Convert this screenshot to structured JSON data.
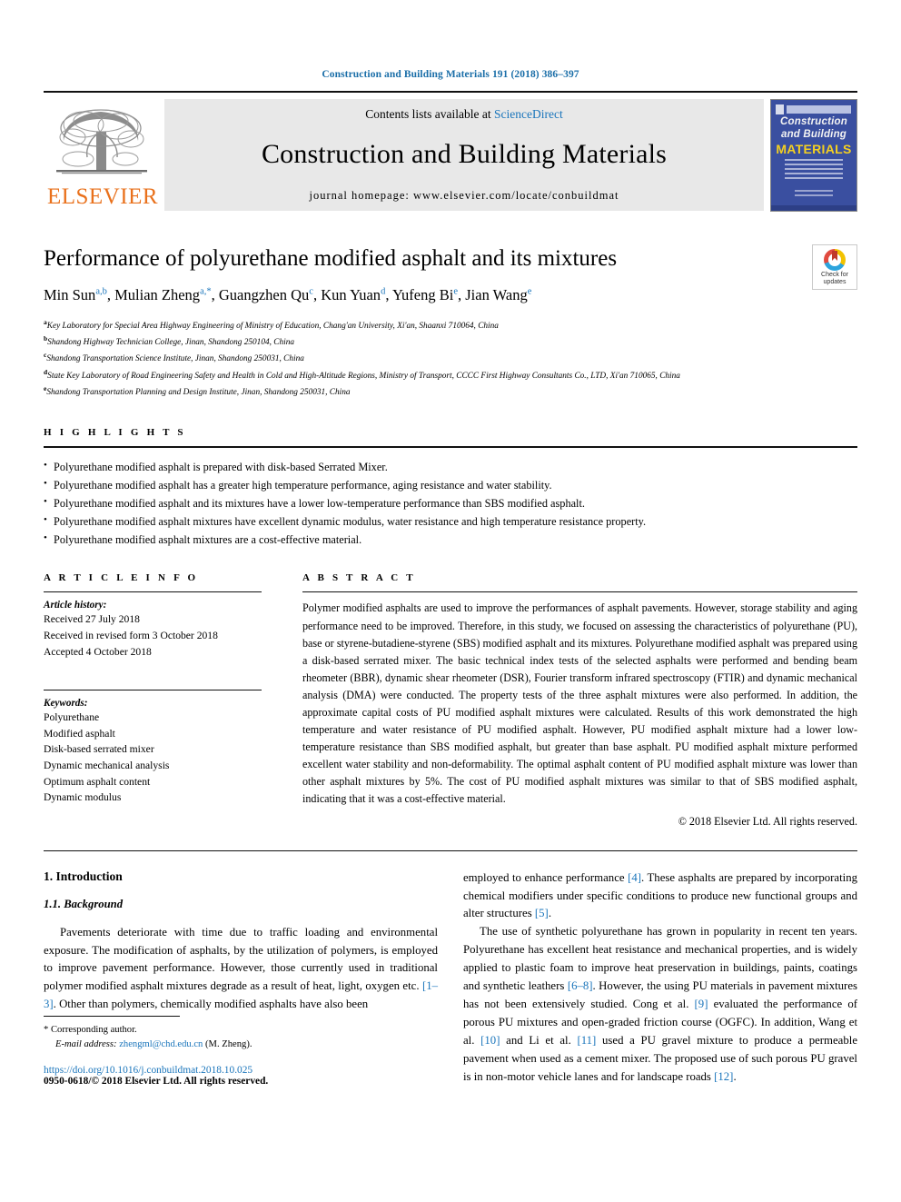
{
  "running_head": "Construction and Building Materials 191 (2018) 386–397",
  "masthead": {
    "contents_prefix": "Contents lists available at ",
    "sciencedirect": "ScienceDirect",
    "journal_title": "Construction and Building Materials",
    "homepage": "journal homepage: www.elsevier.com/locate/conbuildmat",
    "publisher": "ELSEVIER",
    "cover": {
      "line1": "Construction",
      "line2": "and Building",
      "line3": "MATERIALS"
    }
  },
  "title": "Performance of polyurethane modified asphalt and its mixtures",
  "crossmark": {
    "line1": "Check for",
    "line2": "updates"
  },
  "authors": [
    {
      "name": "Min Sun",
      "sup": "a,b"
    },
    {
      "name": "Mulian Zheng",
      "sup": "a,*"
    },
    {
      "name": "Guangzhen Qu",
      "sup": "c"
    },
    {
      "name": "Kun Yuan",
      "sup": "d"
    },
    {
      "name": "Yufeng Bi",
      "sup": "e"
    },
    {
      "name": "Jian Wang",
      "sup": "e"
    }
  ],
  "affiliations": [
    {
      "mark": "a",
      "text": "Key Laboratory for Special Area Highway Engineering of Ministry of Education, Chang'an University, Xi'an, Shaanxi 710064, China"
    },
    {
      "mark": "b",
      "text": "Shandong Highway Technician College, Jinan, Shandong 250104, China"
    },
    {
      "mark": "c",
      "text": "Shandong Transportation Science Institute, Jinan, Shandong 250031, China"
    },
    {
      "mark": "d",
      "text": "State Key Laboratory of Road Engineering Safety and Health in Cold and High-Altitude Regions, Ministry of Transport, CCCC First Highway Consultants Co., LTD, Xi'an 710065, China"
    },
    {
      "mark": "e",
      "text": "Shandong Transportation Planning and Design Institute, Jinan, Shandong 250031, China"
    }
  ],
  "highlights": {
    "label": "H I G H L I G H T S",
    "items": [
      "Polyurethane modified asphalt is prepared with disk-based Serrated Mixer.",
      "Polyurethane modified asphalt has a greater high temperature performance, aging resistance and water stability.",
      "Polyurethane modified asphalt and its mixtures have a lower low-temperature performance than SBS modified asphalt.",
      "Polyurethane modified asphalt mixtures have excellent dynamic modulus, water resistance and high temperature resistance property.",
      "Polyurethane modified asphalt mixtures are a cost-effective material."
    ]
  },
  "article_info": {
    "label": "A R T I C L E   I N F O",
    "history_head": "Article history:",
    "history": [
      "Received 27 July 2018",
      "Received in revised form 3 October 2018",
      "Accepted 4 October 2018"
    ],
    "keywords_head": "Keywords:",
    "keywords": [
      "Polyurethane",
      "Modified asphalt",
      "Disk-based serrated mixer",
      "Dynamic mechanical analysis",
      "Optimum asphalt content",
      "Dynamic modulus"
    ]
  },
  "abstract": {
    "label": "A B S T R A C T",
    "text": "Polymer modified asphalts are used to improve the performances of asphalt pavements. However, storage stability and aging performance need to be improved. Therefore, in this study, we focused on assessing the characteristics of polyurethane (PU), base or styrene-butadiene-styrene (SBS) modified asphalt and its mixtures. Polyurethane modified asphalt was prepared using a disk-based serrated mixer. The basic technical index tests of the selected asphalts were performed and bending beam rheometer (BBR), dynamic shear rheometer (DSR), Fourier transform infrared spectroscopy (FTIR) and dynamic mechanical analysis (DMA) were conducted. The property tests of the three asphalt mixtures were also performed. In addition, the approximate capital costs of PU modified asphalt mixtures were calculated. Results of this work demonstrated the high temperature and water resistance of PU modified asphalt. However, PU modified asphalt mixture had a lower low-temperature resistance than SBS modified asphalt, but greater than base asphalt. PU modified asphalt mixture performed excellent water stability and non-deformability. The optimal asphalt content of PU modified asphalt mixture was lower than other asphalt mixtures by 5%. The cost of PU modified asphalt mixtures was similar to that of SBS modified asphalt, indicating that it was a cost-effective material.",
    "copyright": "© 2018 Elsevier Ltd. All rights reserved."
  },
  "body": {
    "section_heading": "1. Introduction",
    "subsection_heading": "1.1. Background",
    "left_paragraph_1_a": "Pavements deteriorate with time due to traffic loading and environmental exposure. The modification of asphalts, by the utilization of polymers, is employed to improve pavement performance. However, those currently used in traditional polymer modified asphalt mixtures degrade as a result of heat, light, oxygen etc. ",
    "left_ref_1": "[1–3]",
    "left_paragraph_1_b": ". Other than polymers, chemically modified asphalts have also been ",
    "right_paragraph_1_a": "employed to enhance performance ",
    "right_ref_4": "[4]",
    "right_paragraph_1_b": ". These asphalts are prepared by incorporating chemical modifiers under specific conditions to produce new functional groups and alter structures ",
    "right_ref_5": "[5]",
    "right_paragraph_1_c": ".",
    "right_paragraph_2_a": "The use of synthetic polyurethane has grown in popularity in recent ten years. Polyurethane has excellent heat resistance and mechanical properties, and is widely applied to plastic foam to improve heat preservation in buildings, paints, coatings and synthetic leathers ",
    "right_ref_68": "[6–8]",
    "right_paragraph_2_b": ". However, the using PU materials in pavement mixtures has not been extensively studied. Cong et al. ",
    "right_ref_9": "[9]",
    "right_paragraph_2_c": " evaluated the performance of porous PU mixtures and open-graded friction course (OGFC). In addition, Wang et al. ",
    "right_ref_10": "[10]",
    "right_paragraph_2_d": " and Li et al. ",
    "right_ref_11": "[11]",
    "right_paragraph_2_e": " used a PU gravel mixture to produce a permeable pavement when used as a cement mixer. The proposed use of such porous PU gravel is in non-motor vehicle lanes and for landscape roads ",
    "right_ref_12": "[12]",
    "right_paragraph_2_f": "."
  },
  "footnote": {
    "corresponding_marker": "*",
    "corresponding_text": "Corresponding author.",
    "email_label": "E-mail address:",
    "email": "zhengml@chd.edu.cn",
    "email_suffix": "(M. Zheng).",
    "doi": "https://doi.org/10.1016/j.conbuildmat.2018.10.025",
    "issn": "0950-0618/© 2018 Elsevier Ltd. All rights reserved."
  }
}
